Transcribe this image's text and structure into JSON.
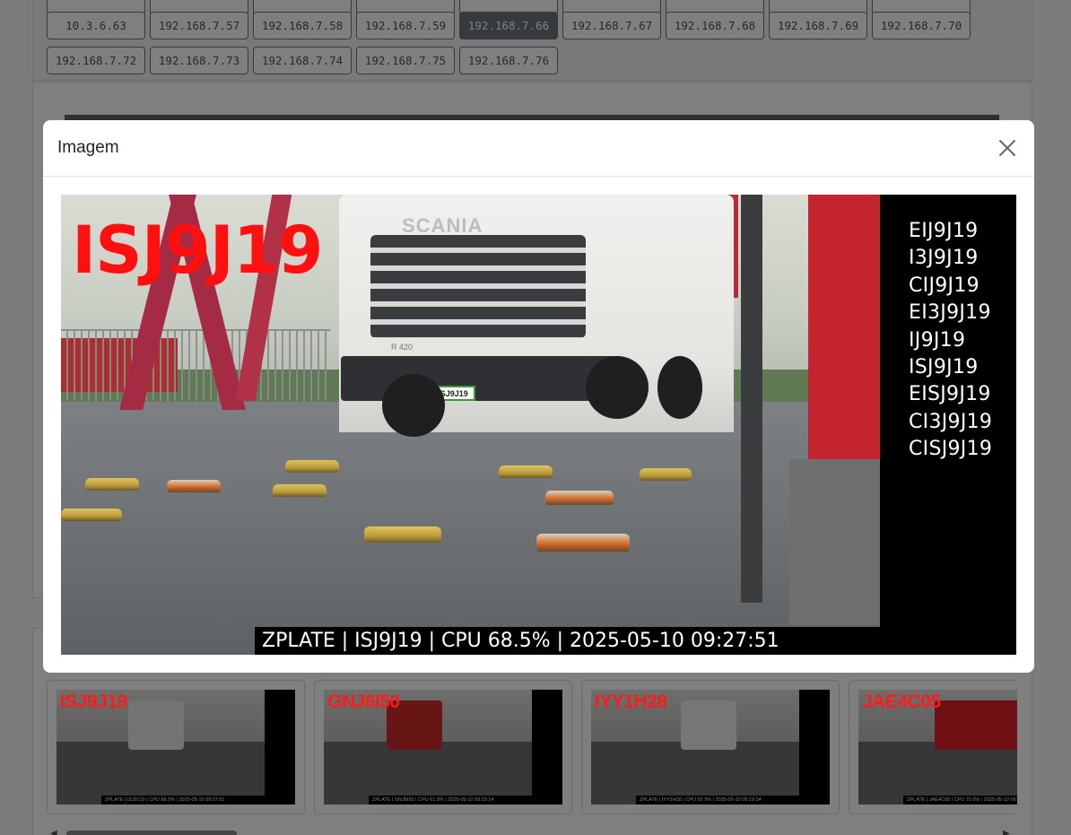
{
  "ip_buttons": {
    "row0": [
      "",
      "",
      "",
      "",
      "",
      "",
      "",
      "",
      ""
    ],
    "row1": [
      "10.3.6.63",
      "192.168.7.57",
      "192.168.7.58",
      "192.168.7.59",
      "192.168.7.66",
      "192.168.7.67",
      "192.168.7.68",
      "192.168.7.69",
      "192.168.7.70"
    ],
    "row2": [
      "192.168.7.72",
      "192.168.7.73",
      "192.168.7.74",
      "192.168.7.75",
      "192.168.7.76"
    ],
    "active": "192.168.7.66"
  },
  "modal": {
    "title": "Imagem",
    "close_icon": "close-icon",
    "image": {
      "plate": "ISJ9J19",
      "truck_brand": "SCANIA",
      "truck_model": "R 420",
      "truck_plate": "ISJ9J19",
      "candidates": [
        "EIJ9J19",
        "I3J9J19",
        "CIJ9J19",
        "EI3J9J19",
        "IJ9J19",
        "ISJ9J19",
        "EISJ9J19",
        "CI3J9J19",
        "CISJ9J19"
      ],
      "footer": "ZPLATE | ISJ9J19 | CPU 68.5% | 2025-05-10 09:27:51"
    }
  },
  "thumbnails": [
    {
      "plate": "ISJ9J19",
      "footer": "ZPLATE | ISJ9J19 | CPU 68.5% | 2025-05-10 09:27:51",
      "truck_color": "#e8e8e4"
    },
    {
      "plate": "GNJ6I50",
      "footer": "ZPLATE | GNJ6I50 | CPU 61.8% | 2025-05-10 09:23:14",
      "truck_color": "#d02a2a"
    },
    {
      "plate": "IYY1H28",
      "footer": "ZPLATE | IYY1H28 | CPU 50.9% | 2025-05-10 09:19:34",
      "truck_color": "#ececec"
    },
    {
      "plate": "JAE4C05",
      "footer": "ZPLATE | JAE4C05 | CPU 70.0% | 2025-05-10 09:15",
      "truck_color": "#e0202a"
    }
  ],
  "colors": {
    "active_button": "#6c757d",
    "plate_text": "#ff1010",
    "backdrop": "rgba(0,0,0,0.5)"
  }
}
